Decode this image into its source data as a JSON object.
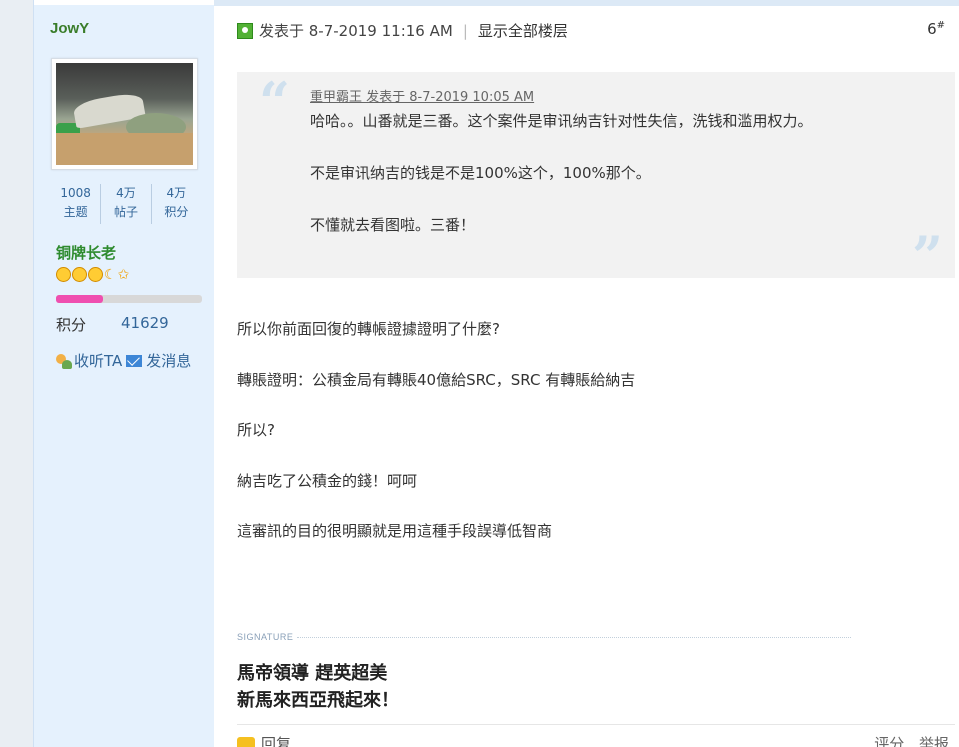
{
  "user": {
    "name": "JowY",
    "stats": [
      {
        "value": "1008",
        "label": "主题"
      },
      {
        "value": "4万",
        "label": "帖子"
      },
      {
        "value": "4万",
        "label": "积分"
      }
    ],
    "rank": "铜牌长老",
    "rank_progress": 0.32,
    "points_label": "积分",
    "points_value": "41629",
    "follow_label": "收听TA",
    "message_label": "发消息"
  },
  "post": {
    "posted_text": "发表于 8-7-2019 11:16 AM",
    "show_all_label": "显示全部楼层",
    "floor_number": "6",
    "floor_mark": "#",
    "quote": {
      "meta": "重甲霸王 发表于 8-7-2019 10:05 AM",
      "paragraphs": [
        "哈哈。。山番就是三番。这个案件是审讯纳吉针对性失信，洗钱和滥用权力。",
        "不是审讯纳吉的钱是不是100%这个，100%那个。",
        "不懂就去看图啦。三番！"
      ]
    },
    "body": [
      "所以你前面回復的轉帳證據證明了什麼?",
      "轉賬證明：公積金局有轉賬40億給SRC，SRC 有轉賬給納吉",
      "所以?",
      "納吉吃了公積金的錢！呵呵",
      "這審訊的目的很明顯就是用這種手段誤導低智商"
    ],
    "signature_label": "SIGNATURE",
    "signature_lines": [
      "馬帝領導  趕英超美",
      "新馬來西亞飛起來！"
    ],
    "reply_label": "回复",
    "rate_label": "评分",
    "report_label": "举报"
  }
}
